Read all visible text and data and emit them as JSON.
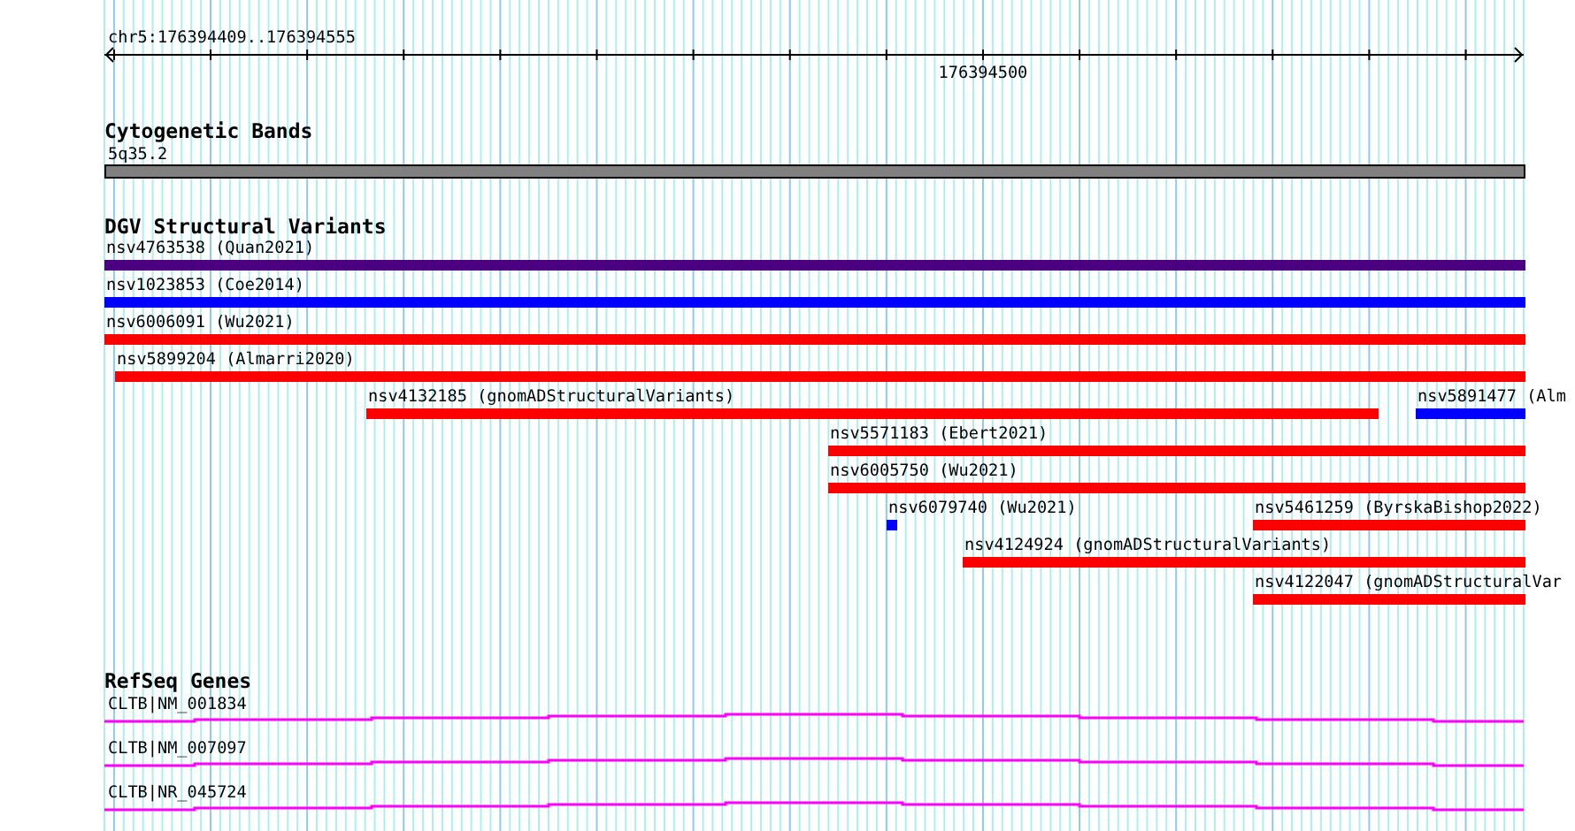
{
  "ruler": {
    "location": "chr5:176394409..176394555",
    "tick_label": "176394500"
  },
  "tracks": [
    {
      "title": "Cytogenetic Bands",
      "kind": "bands",
      "features": [
        {
          "label": "5q35.2"
        }
      ]
    },
    {
      "title": "DGV Structural Variants",
      "kind": "variants",
      "features": [
        {
          "label": "nsv4763538 (Quan2021)",
          "color": "#4b0082"
        },
        {
          "label": "nsv1023853 (Coe2014)",
          "color": "#0000ff"
        },
        {
          "label": "nsv6006091 (Wu2021)",
          "color": "#ff0000"
        },
        {
          "label": "nsv5899204 (Almarri2020)",
          "color": "#ff0000"
        },
        {
          "label": "nsv4132185 (gnomADStructuralVariants)",
          "color": "#ff0000"
        },
        {
          "label": "nsv5891477 (Alm",
          "color": "#0000ff"
        },
        {
          "label": "nsv5571183 (Ebert2021)",
          "color": "#ff0000"
        },
        {
          "label": "nsv6005750 (Wu2021)",
          "color": "#ff0000"
        },
        {
          "label": "nsv6079740 (Wu2021)",
          "color": "#0000ff"
        },
        {
          "label": "nsv5461259 (ByrskaBishop2022)",
          "color": "#ff0000"
        },
        {
          "label": "nsv4124924 (gnomADStructuralVariants)",
          "color": "#ff0000"
        },
        {
          "label": "nsv4122047 (gnomADStructuralVar",
          "color": "#ff0000"
        }
      ]
    },
    {
      "title": "RefSeq Genes",
      "kind": "genes",
      "features": [
        {
          "label": "CLTB|NM_001834"
        },
        {
          "label": "CLTB|NM_007097"
        },
        {
          "label": "CLTB|NR_045724"
        }
      ]
    }
  ]
}
